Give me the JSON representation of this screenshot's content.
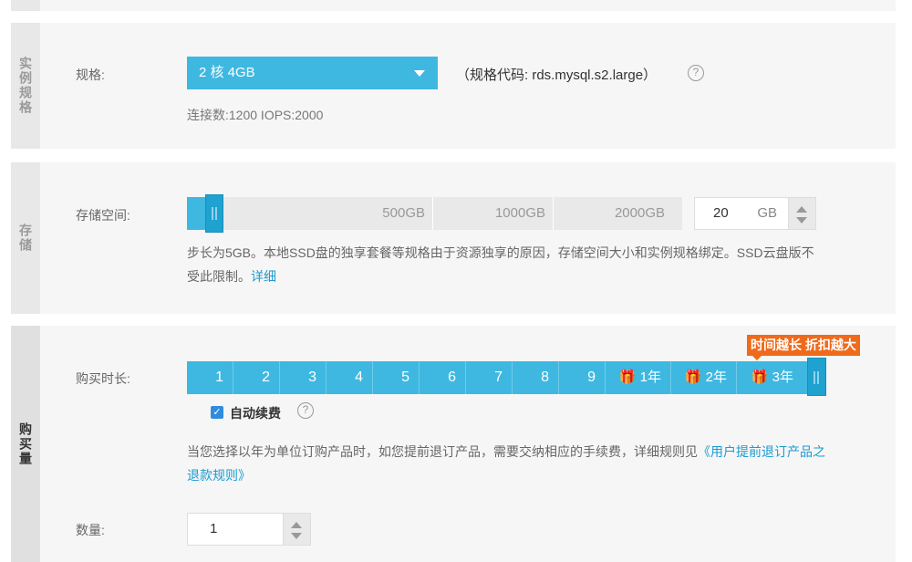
{
  "spec": {
    "section_label": "实例规格",
    "field_label": "规格:",
    "selected": "2 核 4GB",
    "code_text": "（规格代码: rds.mysql.s2.large）",
    "help": "?",
    "info": "连接数:1200 IOPS:2000"
  },
  "storage": {
    "section_label": "存储",
    "field_label": "存储空间:",
    "ticks": [
      "500GB",
      "1000GB",
      "2000GB"
    ],
    "value": "20",
    "unit": "GB",
    "desc_line1": "步长为5GB。本地SSD盘的独享套餐等规格由于资源独享的原因，存储空间大小和实例规格绑定。SSD云盘版不",
    "desc_line2": "受此限制。",
    "desc_link": "详细"
  },
  "purchase": {
    "section_label": "购买量",
    "duration_label": "购买时长:",
    "promo": "时间越长 折扣越大",
    "options": [
      "1",
      "2",
      "3",
      "4",
      "5",
      "6",
      "7",
      "8",
      "9",
      "🎁 1年",
      "🎁 2年",
      "🎁 3年"
    ],
    "auto_renew_label": "自动续费",
    "auto_renew_checked": true,
    "help": "?",
    "refund_text_line1": "当您选择以年为单位订购产品时，如您提前退订产品，需要交纳相应的手续费，详细规则见",
    "refund_link_line1": "《用户提前退订产品之",
    "refund_link_line2": "退款规则》",
    "quantity_label": "数量:",
    "quantity_value": "1"
  },
  "colors": {
    "accent": "#3eb8e0",
    "accent_dark": "#1fa2cf",
    "promo": "#f06a1b",
    "link": "#1a9bd1"
  }
}
